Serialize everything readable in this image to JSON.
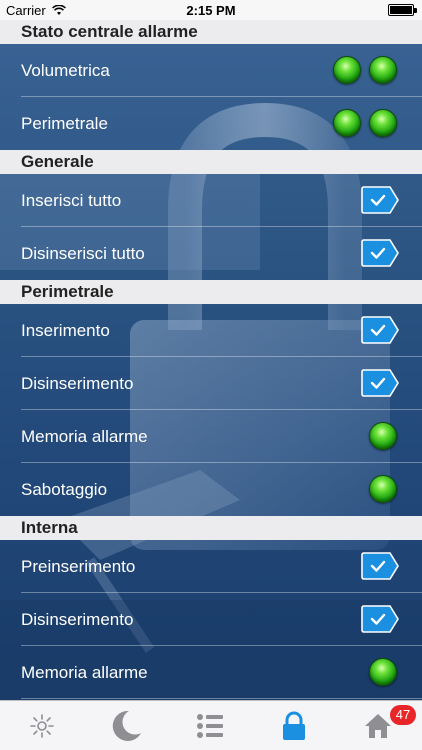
{
  "status_bar": {
    "carrier": "Carrier",
    "time": "2:15 PM"
  },
  "sections": [
    {
      "title": "Stato centrale allarme",
      "rows": [
        {
          "label": "Volumetrica",
          "indicator": "two-green-leds"
        },
        {
          "label": "Perimetrale",
          "indicator": "two-green-leds"
        }
      ]
    },
    {
      "title": "Generale",
      "rows": [
        {
          "label": "Inserisci tutto",
          "indicator": "check-button"
        },
        {
          "label": "Disinserisci tutto",
          "indicator": "check-button"
        }
      ]
    },
    {
      "title": "Perimetrale",
      "rows": [
        {
          "label": "Inserimento",
          "indicator": "check-button"
        },
        {
          "label": "Disinserimento",
          "indicator": "check-button"
        },
        {
          "label": "Memoria allarme",
          "indicator": "green-led"
        },
        {
          "label": "Sabotaggio",
          "indicator": "green-led"
        }
      ]
    },
    {
      "title": "Interna",
      "rows": [
        {
          "label": "Preinserimento",
          "indicator": "check-button"
        },
        {
          "label": "Disinserimento",
          "indicator": "check-button"
        },
        {
          "label": "Memoria allarme",
          "indicator": "green-led"
        }
      ]
    }
  ],
  "tab_bar": {
    "tabs": [
      {
        "icon": "sun-icon",
        "active": false
      },
      {
        "icon": "moon-icon",
        "active": false
      },
      {
        "icon": "list-icon",
        "active": false
      },
      {
        "icon": "lock-icon",
        "active": true
      },
      {
        "icon": "home-icon",
        "active": false
      }
    ],
    "home_badge": "47"
  },
  "colors": {
    "accent": "#1b8fe0",
    "led_green": "#2fbf1a",
    "badge_red": "#e8262a",
    "section_header_bg": "#ececef"
  }
}
